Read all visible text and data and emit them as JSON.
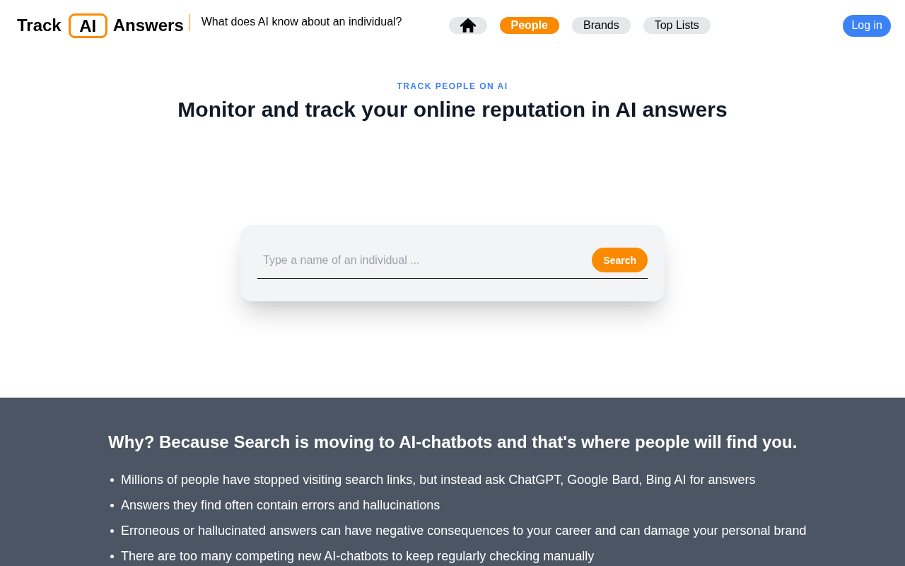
{
  "header": {
    "logo": {
      "left": "Track",
      "boxed": "AI",
      "right": "Answers"
    },
    "tagline": "What does AI know about an individual?",
    "nav": [
      {
        "kind": "home",
        "selected": false
      },
      {
        "kind": "link",
        "label": "People",
        "selected": true
      },
      {
        "kind": "link",
        "label": "Brands",
        "selected": false
      },
      {
        "kind": "link",
        "label": "Top Lists",
        "selected": false
      }
    ],
    "login_button": "Log in"
  },
  "hero": {
    "eyebrow": "TRACK PEOPLE ON AI",
    "title": "Monitor and track your online reputation in AI answers"
  },
  "search": {
    "placeholder": "Type a name of an individual ...",
    "button": "Search"
  },
  "why": {
    "heading": "Why? Because Search is moving to AI-chatbots and that's where people will find you.",
    "points": [
      "Millions of people have stopped visiting search links, but instead ask ChatGPT, Google Bard, Bing AI for answers",
      "Answers they find often contain errors and hallucinations",
      "Erroneous or hallucinated answers can have negative consequences to your career and can damage your personal brand",
      "There are too many competing new AI-chatbots to keep regularly checking manually"
    ]
  }
}
